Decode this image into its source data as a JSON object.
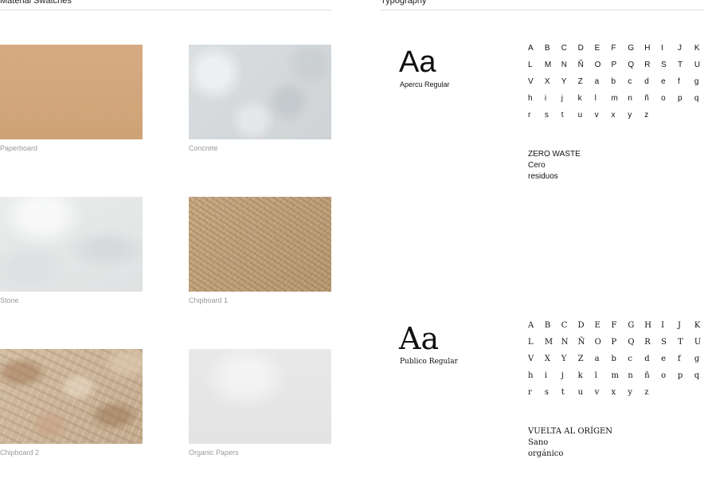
{
  "materials": {
    "title": "Material Swatches",
    "swatches": [
      {
        "label": "Paperboard",
        "color": "#d3a77d"
      },
      {
        "label": "Concrete",
        "color": "#d8dcdf"
      },
      {
        "label": "Stone",
        "color": "#e5e7e8"
      },
      {
        "label": "Chipboard 1",
        "color": "#bfa27c"
      },
      {
        "label": "Chipboard 2",
        "color": "#cdb79d"
      },
      {
        "label": "Organic Papers",
        "color": "#e6e7e6"
      }
    ]
  },
  "typography": {
    "title": "Typography",
    "fonts": [
      {
        "sample": "Aa",
        "name": "Apercu Regular",
        "glyphs": [
          "A",
          "B",
          "C",
          "D",
          "E",
          "F",
          "G",
          "H",
          "I",
          "J",
          "K",
          "L",
          "M",
          "N",
          "Ñ",
          "O",
          "P",
          "Q",
          "R",
          "S",
          "T",
          "U",
          "V",
          "X",
          "Y",
          "Z",
          "a",
          "b",
          "c",
          "d",
          "e",
          "f",
          "g",
          "h",
          "i",
          "j",
          "k",
          "l",
          "m",
          "n",
          "ñ",
          "o",
          "p",
          "q",
          "r",
          "s",
          "t",
          "u",
          "v",
          "x",
          "y",
          "z"
        ],
        "text_lines": [
          "ZERO WASTE",
          "Cero",
          "residuos"
        ]
      },
      {
        "sample": "Aa",
        "name": "Publico Regular",
        "glyphs": [
          "A",
          "B",
          "C",
          "D",
          "E",
          "F",
          "G",
          "H",
          "I",
          "J",
          "K",
          "L",
          "M",
          "N",
          "Ñ",
          "O",
          "P",
          "Q",
          "R",
          "S",
          "T",
          "U",
          "V",
          "X",
          "Y",
          "Z",
          "a",
          "b",
          "c",
          "d",
          "e",
          "f",
          "g",
          "h",
          "i",
          "j",
          "k",
          "l",
          "m",
          "n",
          "ñ",
          "o",
          "p",
          "q",
          "r",
          "s",
          "t",
          "u",
          "v",
          "x",
          "y",
          "z"
        ],
        "text_lines": [
          "VUELTA AL ORÍGEN",
          "Sano",
          "orgánico"
        ]
      }
    ]
  }
}
